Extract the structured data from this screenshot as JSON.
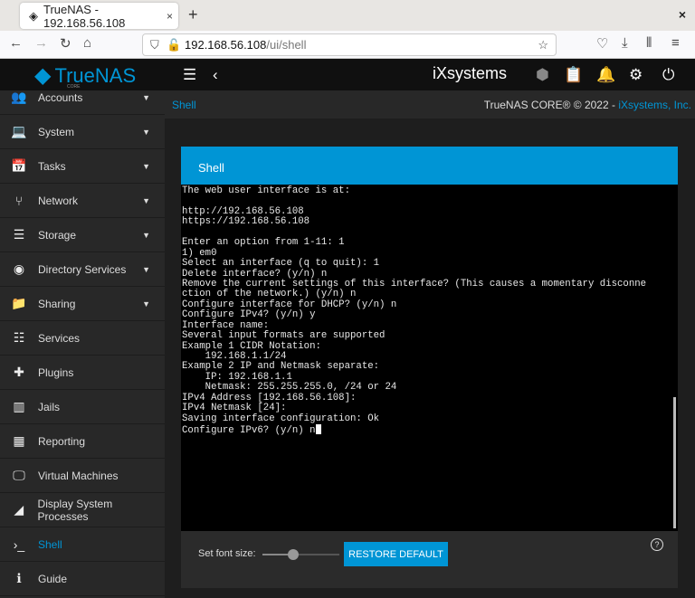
{
  "browser": {
    "tab_title": "TrueNAS - 192.168.56.108",
    "url_host": "192.168.56.108",
    "url_path": "/ui/shell"
  },
  "header": {
    "logo": "TrueNAS",
    "logo_sub": "CORE",
    "vendor_logo": "iXsystems"
  },
  "sidebar": {
    "items": [
      {
        "label": "Accounts",
        "icon": "people-icon",
        "ic": "👥",
        "expand": true
      },
      {
        "label": "System",
        "icon": "laptop-icon",
        "ic": "💻",
        "expand": true
      },
      {
        "label": "Tasks",
        "icon": "calendar-icon",
        "ic": "📅",
        "expand": true
      },
      {
        "label": "Network",
        "icon": "network-icon",
        "ic": "⑂",
        "expand": true
      },
      {
        "label": "Storage",
        "icon": "storage-icon",
        "ic": "☰",
        "expand": true
      },
      {
        "label": "Directory Services",
        "icon": "directory-icon",
        "ic": "◉",
        "expand": true
      },
      {
        "label": "Sharing",
        "icon": "folder-shared-icon",
        "ic": "📁",
        "expand": true
      },
      {
        "label": "Services",
        "icon": "tune-icon",
        "ic": "☷",
        "expand": false
      },
      {
        "label": "Plugins",
        "icon": "puzzle-icon",
        "ic": "✚",
        "expand": false
      },
      {
        "label": "Jails",
        "icon": "jail-icon",
        "ic": "▥",
        "expand": false
      },
      {
        "label": "Reporting",
        "icon": "chart-icon",
        "ic": "▦",
        "expand": false
      },
      {
        "label": "Virtual Machines",
        "icon": "monitor-icon",
        "ic": "🖵",
        "expand": false
      },
      {
        "label": "Display System Processes",
        "icon": "processes-icon",
        "ic": "◢",
        "expand": false
      },
      {
        "label": "Shell",
        "icon": "terminal-icon",
        "ic": "›_",
        "expand": false,
        "active": true
      },
      {
        "label": "Guide",
        "icon": "info-icon",
        "ic": "ℹ",
        "expand": false
      }
    ]
  },
  "breadcrumb": {
    "title": "Shell",
    "copyright": "TrueNAS CORE® © 2022 - ",
    "company": "iXsystems, Inc."
  },
  "shell": {
    "title": "Shell",
    "lines": [
      "The web user interface is at:",
      "",
      "http://192.168.56.108",
      "https://192.168.56.108",
      "",
      "Enter an option from 1-11: 1",
      "1) em0",
      "Select an interface (q to quit): 1",
      "Delete interface? (y/n) n",
      "Remove the current settings of this interface? (This causes a momentary disconne",
      "ction of the network.) (y/n) n",
      "Configure interface for DHCP? (y/n) n",
      "Configure IPv4? (y/n) y",
      "Interface name:",
      "Several input formats are supported",
      "Example 1 CIDR Notation:",
      "    192.168.1.1/24",
      "Example 2 IP and Netmask separate:",
      "    IP: 192.168.1.1",
      "    Netmask: 255.255.255.0, /24 or 24",
      "IPv4 Address [192.168.56.108]:",
      "IPv4 Netmask [24]:",
      "Saving interface configuration: Ok",
      "Configure IPv6? (y/n) n"
    ],
    "font_size_label": "Set font size:",
    "font_size_fraction": 0.4,
    "restore_label": "RESTORE DEFAULT"
  },
  "colors": {
    "accent": "#0095d5"
  }
}
